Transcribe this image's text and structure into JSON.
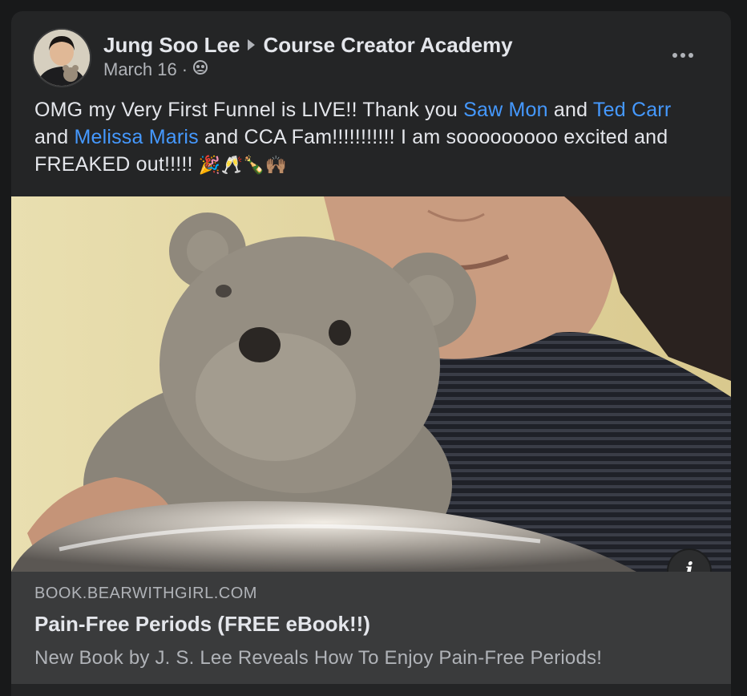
{
  "post": {
    "author": "Jung Soo Lee",
    "group": "Course Creator Academy",
    "date": "March 16",
    "separator": "·",
    "privacy_icon": "group-members-icon",
    "text": {
      "p1": "OMG my Very First Funnel is LIVE!! Thank you ",
      "mention1": "Saw Mon",
      "p2": " and ",
      "mention2": "Ted Carr",
      "p3": " and ",
      "mention3": "Melissa Maris",
      "p4": " and CCA Fam!!!!!!!!!!! I am sooooooooo excited and FREAKED out!!!!! ",
      "emojis": "🎉🥂🍾🙌🏽"
    },
    "more_icon": "more-options-icon"
  },
  "link_preview": {
    "domain": "BOOK.BEARWITHGIRL.COM",
    "title": "Pain-Free Periods (FREE eBook!!)",
    "description": "New Book by J. S. Lee Reveals How To Enjoy Pain-Free Periods!",
    "info_label": "i"
  },
  "colors": {
    "background": "#18191a",
    "card": "#242526",
    "link_box": "#3a3b3c",
    "primary_text": "#e4e6eb",
    "secondary_text": "#b0b3b8",
    "mention": "#4599ff"
  }
}
